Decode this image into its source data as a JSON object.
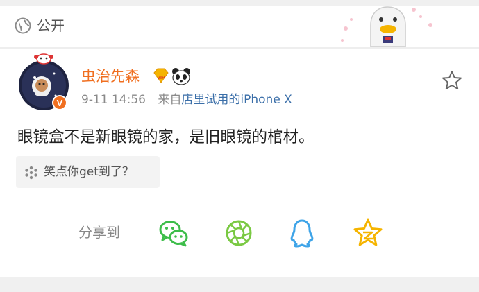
{
  "header": {
    "visibility_label": "公开",
    "visibility_icon": "globe-icon"
  },
  "post": {
    "author": "虫治先森",
    "time": "9-11 14:56",
    "source_prefix": "来自",
    "source_link": "店里试用的iPhone X",
    "content": "眼镜盒不是新眼镜的家，是旧眼镜的棺材。",
    "topic_tag": "笑点你get到了？",
    "vip_badge_text": "VIP"
  },
  "share": {
    "label": "分享到",
    "targets": [
      "wechat-icon",
      "moments-icon",
      "qq-icon",
      "qzone-icon"
    ]
  },
  "colors": {
    "author": "#f06f20",
    "link": "#3a6ea8",
    "wechat": "#3dbd4a",
    "moments": "#7ac943",
    "qq": "#3ea4e8",
    "qzone": "#f5b400"
  }
}
